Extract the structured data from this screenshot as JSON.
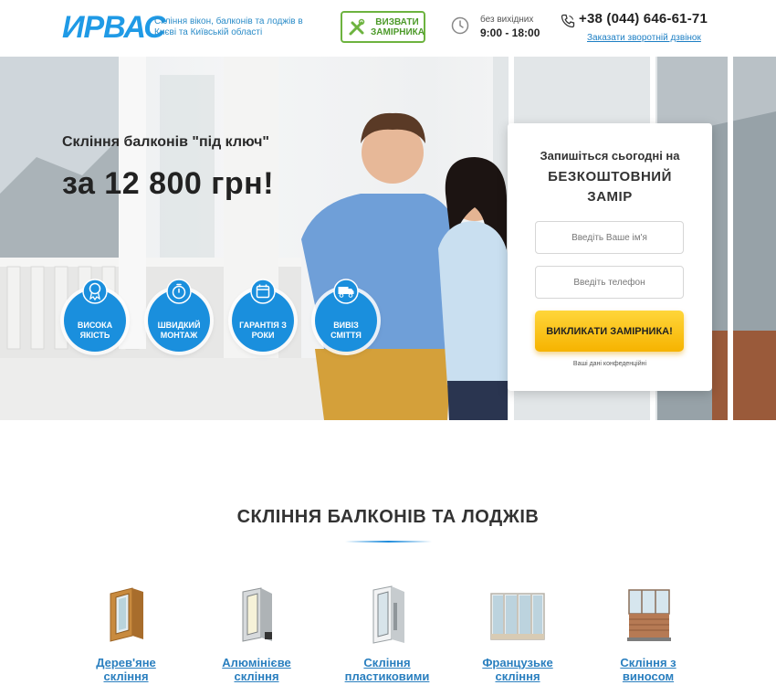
{
  "header": {
    "logo": "ИРВАС",
    "tagline": "Скління вікон, балконів та лоджів в Києві та Київській області",
    "call_button": "ВИЗВАТИ ЗАМІРНИКА",
    "hours_label": "без вихідних",
    "hours": "9:00 - 18:00",
    "phone": "+38 (044) 646-61-71",
    "callback_link": "Заказати зворотній дзвінок"
  },
  "hero": {
    "subtitle": "Скління балконів \"під ключ\"",
    "price": "за 12 800 грн!",
    "features": [
      {
        "label": "ВИСОКА ЯКІСТЬ",
        "icon": "award-icon"
      },
      {
        "label": "ШВИДКИЙ МОНТАЖ",
        "icon": "stopwatch-icon"
      },
      {
        "label": "ГАРАНТІЯ З РОКИ",
        "icon": "calendar-icon"
      },
      {
        "label": "ВИВІЗ СМІТТЯ",
        "icon": "truck-icon"
      }
    ]
  },
  "form": {
    "title_line1": "Запишіться сьогодні на",
    "title_line2": "БЕЗКОШТОВНИЙ ЗАМІР",
    "name_placeholder": "Введіть Ваше ім'я",
    "phone_placeholder": "Введіть телефон",
    "submit": "ВИКЛИКАТИ ЗАМІРНИКА!",
    "privacy": "Ваші дані конфеденційні"
  },
  "section": {
    "title": "СКЛІННЯ БАЛКОНІВ ТА ЛОДЖІВ",
    "products": [
      {
        "label": "Дерев'яне скління"
      },
      {
        "label": "Алюмінієве скління"
      },
      {
        "label": "Скління пластиковими"
      },
      {
        "label": "Французьке скління"
      },
      {
        "label": "Скління з виносом"
      }
    ]
  },
  "colors": {
    "brand_blue": "#1a8fdd",
    "accent_yellow": "#f6b300",
    "call_green": "#6db33f",
    "link_blue": "#2a7fbf"
  }
}
